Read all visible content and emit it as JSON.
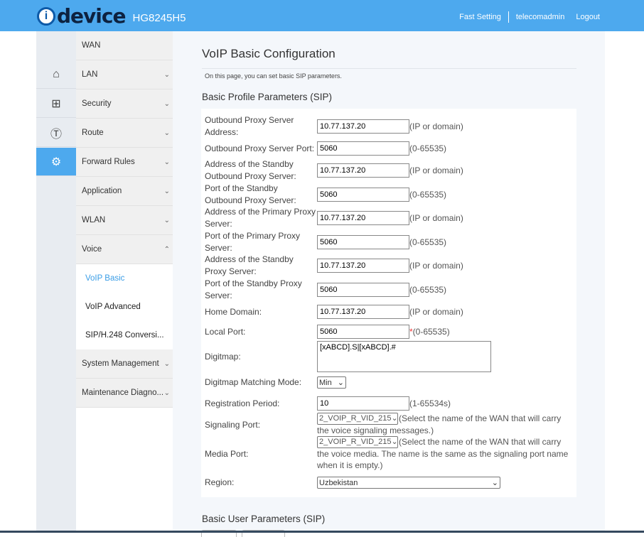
{
  "header": {
    "logo": "device",
    "logo_letter": "i",
    "model": "HG8245H5",
    "fast_setting": "Fast Setting",
    "user": "telecomadmin",
    "logout": "Logout"
  },
  "rail": [
    {
      "icon": "home-icon"
    },
    {
      "icon": "medkit-icon"
    },
    {
      "icon": "pulse-icon"
    },
    {
      "icon": "gear-icon",
      "active": true
    }
  ],
  "menu": {
    "wan": "WAN",
    "lan": "LAN",
    "security": "Security",
    "route": "Route",
    "forward": "Forward Rules",
    "application": "Application",
    "wlan": "WLAN",
    "voice": "Voice",
    "voip_basic": "VoIP Basic",
    "voip_advanced": "VoIP Advanced",
    "sip_conv": "SIP/H.248 Conversi...",
    "system": "System Management",
    "maintenance": "Maintenance Diagno..."
  },
  "page": {
    "title": "VoIP Basic Configuration",
    "description": "On this page, you can set basic SIP parameters.",
    "section1": "Basic Profile Parameters (SIP)",
    "section2": "Basic User Parameters (SIP)"
  },
  "form": {
    "outbound_addr": {
      "label": "Outbound Proxy Server Address:",
      "value": "10.77.137.20",
      "hint": "(IP or domain)"
    },
    "outbound_port": {
      "label": "Outbound Proxy Server Port:",
      "value": "5060",
      "hint": "(0-65535)"
    },
    "standby_out_addr": {
      "label": "Address of the Standby Outbound Proxy Server:",
      "value": "10.77.137.20",
      "hint": "(IP or domain)"
    },
    "standby_out_port": {
      "label": "Port of the Standby Outbound Proxy Server:",
      "value": "5060",
      "hint": "(0-65535)"
    },
    "primary_addr": {
      "label": "Address of the Primary Proxy Server:",
      "value": "10.77.137.20",
      "hint": "(IP or domain)"
    },
    "primary_port": {
      "label": "Port of the Primary Proxy Server:",
      "value": "5060",
      "hint": "(0-65535)"
    },
    "standby_addr": {
      "label": "Address of the Standby Proxy Server:",
      "value": "10.77.137.20",
      "hint": "(IP or domain)"
    },
    "standby_port": {
      "label": "Port of the Standby Proxy Server:",
      "value": "5060",
      "hint": "(0-65535)"
    },
    "home_domain": {
      "label": "Home Domain:",
      "value": "10.77.137.20",
      "hint": "(IP or domain)"
    },
    "local_port": {
      "label": "Local Port:",
      "value": "5060",
      "req": "*",
      "hint": "(0-65535)"
    },
    "digitmap": {
      "label": "Digitmap:",
      "value": "[xABCD].S|[xABCD].#"
    },
    "matching": {
      "label": "Digitmap Matching Mode:",
      "value": "Min"
    },
    "reg_period": {
      "label": "Registration Period:",
      "value": "10",
      "hint": "(1-65534s)"
    },
    "signaling": {
      "label": "Signaling Port:",
      "value": "2_VOIP_R_VID_215",
      "hint": "(Select the name of the WAN that will carry the voice signaling messages.)"
    },
    "media": {
      "label": "Media Port:",
      "value": "2_VOIP_R_VID_215",
      "hint": "(Select the name of the WAN that will carry the voice media. The name is the same as the signaling port name when it is empty.)"
    },
    "region": {
      "label": "Region:",
      "value": "Uzbekistan"
    }
  }
}
